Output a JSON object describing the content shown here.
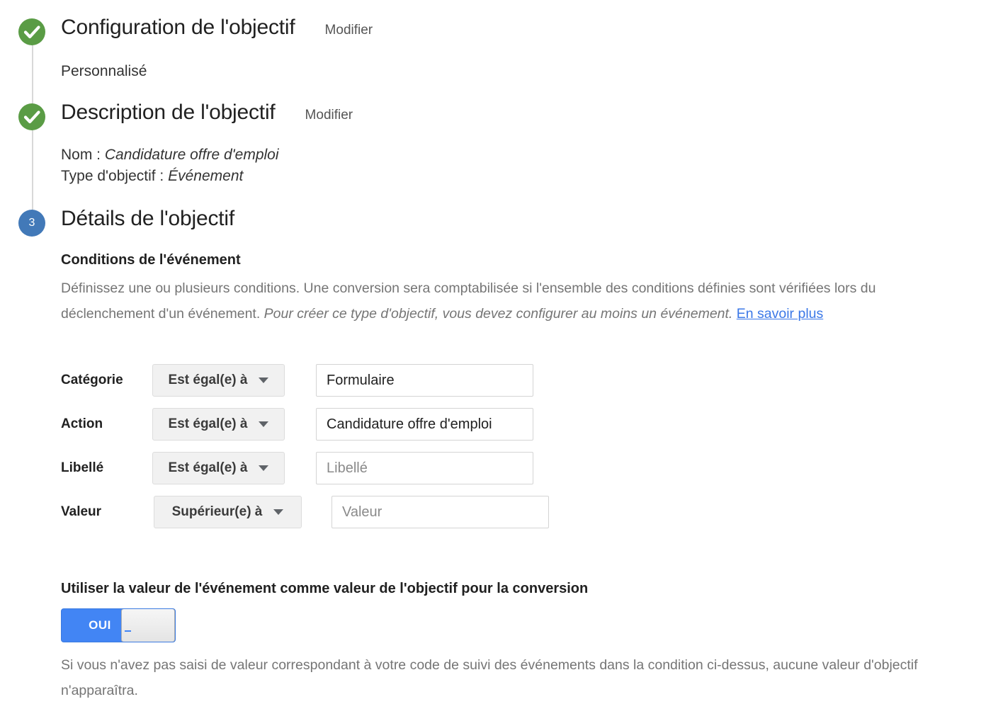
{
  "stepper": {
    "steps": [
      {
        "id": "goal-setup",
        "status": "done",
        "title": "Configuration de l'objectif",
        "edit_label": "Modifier",
        "summary": "Personnalisé"
      },
      {
        "id": "goal-description",
        "status": "done",
        "title": "Description de l'objectif",
        "edit_label": "Modifier",
        "line1_label": "Nom :",
        "line1_value": "Candidature offre d'emploi",
        "line2_label": "Type d'objectif :",
        "line2_value": "Événement"
      },
      {
        "id": "goal-details",
        "status": "current",
        "number": "3",
        "title": "Détails de l'objectif"
      }
    ]
  },
  "details": {
    "section_title": "Conditions de l'événement",
    "description_part1": "Définissez une ou plusieurs conditions. Une conversion sera comptabilisée si l'ensemble des conditions définies sont vérifiées lors du déclenchement d'un événement. ",
    "description_italic": "Pour créer ce type d'objectif, vous devez configurer au moins un événement.",
    "description_link": "En savoir plus",
    "conditions": [
      {
        "label": "Catégorie",
        "operator": "Est égal(e) à",
        "value": "Formulaire",
        "placeholder": "Catégorie"
      },
      {
        "label": "Action",
        "operator": "Est égal(e) à",
        "value": "Candidature offre d'emploi",
        "placeholder": "Action"
      },
      {
        "label": "Libellé",
        "operator": "Est égal(e) à",
        "value": "",
        "placeholder": "Libellé"
      },
      {
        "label": "Valeur",
        "operator": "Supérieur(e) à",
        "value": "",
        "placeholder": "Valeur"
      }
    ]
  },
  "value_toggle": {
    "title": "Utiliser la valeur de l'événement comme valeur de l'objectif pour la conversion",
    "state_label": "OUI",
    "note": "Si vous n'avez pas saisi de valeur correspondant à votre code de suivi des événements dans la condition ci-dessus, aucune valeur d'objectif n'apparaîtra."
  },
  "colors": {
    "done": "#5a9c45",
    "current": "#4279b8",
    "link": "#3b78e7",
    "toggle_on": "#4285f4"
  }
}
